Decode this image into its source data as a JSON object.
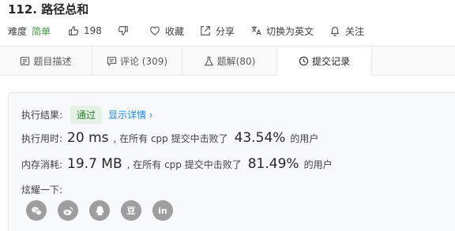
{
  "problem": {
    "title": "112. 路径总和",
    "difficulty_label": "难度",
    "difficulty_value": "简单",
    "likes": "198",
    "favorite_label": "收藏",
    "share_label": "分享",
    "switch_lang_label": "切换为英文",
    "follow_label": "关注"
  },
  "tabs": [
    {
      "label": "题目描述",
      "icon": "description-icon"
    },
    {
      "label": "评论 (309)",
      "icon": "comment-icon"
    },
    {
      "label": "题解(80)",
      "icon": "flask-icon"
    },
    {
      "label": "提交记录",
      "icon": "clock-icon",
      "active": true
    }
  ],
  "result": {
    "status_label": "执行结果:",
    "status_value": "通过",
    "details_link": "显示详情 ›",
    "runtime_label": "执行用时:",
    "runtime_value": "20 ms",
    "runtime_text": ", 在所有 cpp 提交中击败了",
    "runtime_pct": "43.54%",
    "runtime_suffix": "的用户",
    "memory_label": "内存消耗:",
    "memory_value": "19.7 MB",
    "memory_text": ", 在所有 cpp 提交中击败了",
    "memory_pct": "81.49%",
    "memory_suffix": "的用户",
    "share_prompt": "炫耀一下:"
  },
  "share_buttons": [
    {
      "name": "wechat-icon"
    },
    {
      "name": "weibo-icon"
    },
    {
      "name": "qq-icon"
    },
    {
      "name": "douban-icon",
      "glyph": "豆"
    },
    {
      "name": "linkedin-icon",
      "glyph": "in"
    }
  ],
  "colors": {
    "easy": "#43a047",
    "accepted_bg": "#e3f2e5",
    "accepted_text": "#2e7d32",
    "link": "#1e88e5",
    "share_button": "#9e9e9e"
  }
}
